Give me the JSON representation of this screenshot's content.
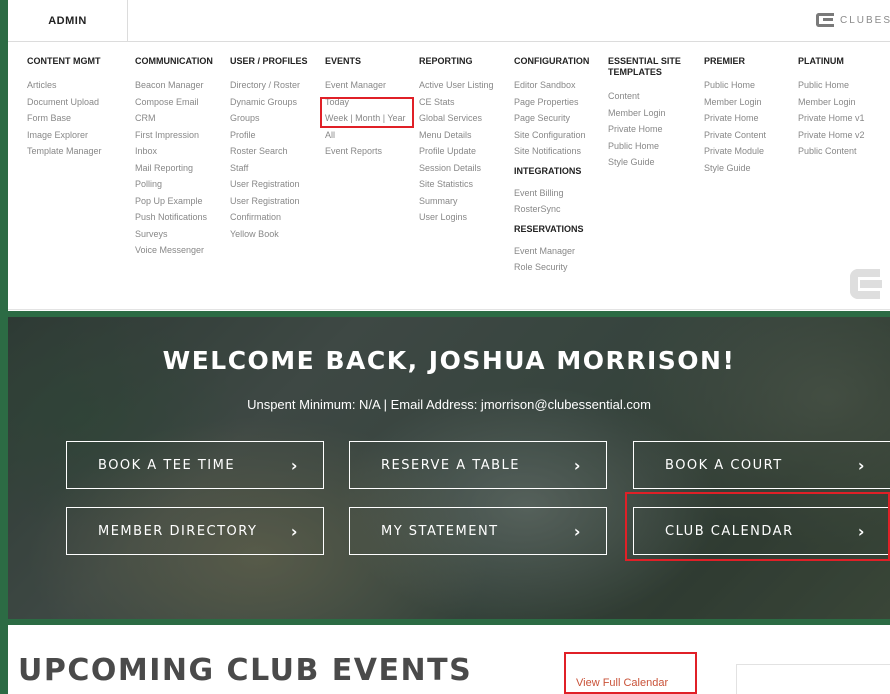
{
  "topbar": {
    "admin_label": "ADMIN",
    "brand_text": "CLUBESSE"
  },
  "menu": {
    "columns": [
      {
        "id": "content",
        "heading": "CONTENT MGMT",
        "items": [
          "Articles",
          "Document Upload",
          "Form Base",
          "Image Explorer",
          "Template Manager"
        ]
      },
      {
        "id": "communication",
        "heading": "COMMUNICATION",
        "items": [
          "Beacon Manager",
          "Compose Email",
          "CRM",
          "First Impression",
          "Inbox",
          "Mail Reporting",
          "Polling",
          "Pop Up Example",
          "Push Notifications",
          "Surveys",
          "Voice Messenger"
        ]
      },
      {
        "id": "user",
        "heading": "USER / PROFILES",
        "items": [
          "Directory / Roster",
          "Dynamic Groups",
          "Groups",
          "Profile",
          "Roster Search",
          "Staff",
          "User Registration",
          "User Registration",
          "Confirmation",
          "Yellow Book"
        ]
      },
      {
        "id": "events",
        "heading": "EVENTS",
        "items": [
          "Event Manager",
          "Today",
          "Week | Month | Year",
          "All",
          "Event Reports"
        ]
      },
      {
        "id": "reporting",
        "heading": "REPORTING",
        "items": [
          "Active User Listing",
          "CE Stats",
          "Global Services",
          "Menu Details",
          "Profile Update",
          "Session Details",
          "Site Statistics",
          "Summary",
          "User Logins"
        ]
      },
      {
        "id": "configuration",
        "heading": "CONFIGURATION",
        "items": [
          "Editor Sandbox",
          "Page Properties",
          "Page Security",
          "Site Configuration",
          "Site Notifications"
        ],
        "subsections": [
          {
            "heading": "INTEGRATIONS",
            "items": [
              "Event Billing",
              "RosterSync"
            ]
          },
          {
            "heading": "RESERVATIONS",
            "items": [
              "Event Manager",
              "Role Security"
            ]
          }
        ]
      },
      {
        "id": "essential",
        "heading": "ESSENTIAL SITE TEMPLATES",
        "items": [
          "Content",
          "Member Login",
          "Private Home",
          "Public Home",
          "Style Guide"
        ]
      },
      {
        "id": "premier",
        "heading": "PREMIER",
        "items": [
          "Public Home",
          "Member Login",
          "Private Home",
          "Private Content",
          "Private Module",
          "Style Guide"
        ]
      },
      {
        "id": "platinum",
        "heading": "PLATINUM",
        "items": [
          "Public Home",
          "Member Login",
          "Private Home v1",
          "Private Home v2",
          "Public Content"
        ]
      }
    ]
  },
  "hero": {
    "welcome": "WELCOME BACK, JOSHUA MORRISON!",
    "subline": "Unspent Minimum: N/A | Email Address: jmorrison@clubessential.com",
    "buttons": [
      "BOOK A TEE TIME",
      "RESERVE A TABLE",
      "BOOK A COURT",
      "MEMBER DIRECTORY",
      "MY STATEMENT",
      "CLUB CALENDAR"
    ],
    "chevron": "›"
  },
  "events": {
    "heading": "UPCOMING CLUB EVENTS",
    "full_calendar_link": "View Full Calendar"
  },
  "colors": {
    "brand_green": "#2c6b44",
    "highlight_red": "#e02027",
    "link_orange": "#c95238"
  }
}
